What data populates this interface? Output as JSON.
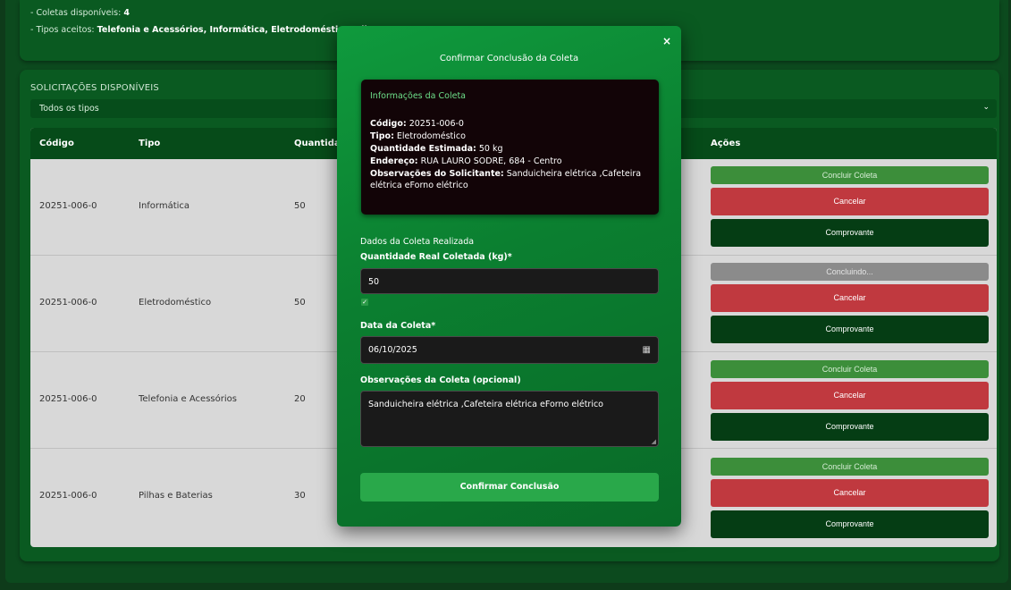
{
  "top": {
    "line1_label": "- Coletas disponíveis:",
    "line1_value": "4",
    "line2_label": "- Tipos aceitos:",
    "line2_value": "Telefonia e Acessórios, Informática, Eletrodoméstico, Pil"
  },
  "section_title": "SOLICITAÇÕES DISPONÍVEIS",
  "filter": {
    "selected": "Todos os tipos"
  },
  "table": {
    "headers": {
      "codigo": "Código",
      "tipo": "Tipo",
      "quantidade": "Quantidad",
      "acoes": "Ações"
    },
    "rows": [
      {
        "codigo": "20251-006-0",
        "tipo": "Informática",
        "quantidade": "50",
        "action1": "Concluir Coleta",
        "action1_state": "normal",
        "cancel": "Cancelar",
        "receipt": "Comprovante"
      },
      {
        "codigo": "20251-006-0",
        "tipo": "Eletrodoméstico",
        "quantidade": "50",
        "action1": "Concluindo...",
        "action1_state": "loading",
        "cancel": "Cancelar",
        "receipt": "Comprovante"
      },
      {
        "codigo": "20251-006-0",
        "tipo": "Telefonia e Acessórios",
        "quantidade": "20",
        "action1": "Concluir Coleta",
        "action1_state": "normal",
        "cancel": "Cancelar",
        "receipt": "Comprovante"
      },
      {
        "codigo": "20251-006-0",
        "tipo": "Pilhas e Baterias",
        "quantidade": "30",
        "action1": "Concluir Coleta",
        "action1_state": "normal",
        "cancel": "Cancelar",
        "receipt": "Comprovante"
      }
    ]
  },
  "modal": {
    "close": "×",
    "title": "Confirmar Conclusão da Coleta",
    "info": {
      "title": "Informações da Coleta",
      "codigo_label": "Código:",
      "codigo": "20251-006-0",
      "tipo_label": "Tipo:",
      "tipo": "Eletrodoméstico",
      "quantidade_label": "Quantidade Estimada:",
      "quantidade": "50 kg",
      "endereco_label": "Endereço:",
      "endereco": "RUA LAURO SODRE, 684 - Centro",
      "obs_label": "Observações do Solicitante:",
      "obs": "Sanduicheira elétrica ,Cafeteira elétrica eForno elétrico"
    },
    "section": "Dados da Coleta Realizada",
    "qty_label": "Quantidade Real Coletada (kg)*",
    "qty_value": "50",
    "date_label": "Data da Coleta*",
    "date_value": "06/10/2025",
    "obs_label": "Observações da Coleta (opcional)",
    "obs_value": "Sanduicheira elétrica  ,Cafeteira elétrica eForno elétrico",
    "confirm": "Confirmar Conclusão"
  },
  "colors": {
    "accent": "#29a84a",
    "danger": "#c0393f",
    "dark_green": "#053d14",
    "disabled": "#8b8b8b"
  },
  "icons": {
    "close": "close-icon",
    "chevron": "chevron-down-icon",
    "calendar": "calendar-icon",
    "check": "checkmark-icon"
  }
}
